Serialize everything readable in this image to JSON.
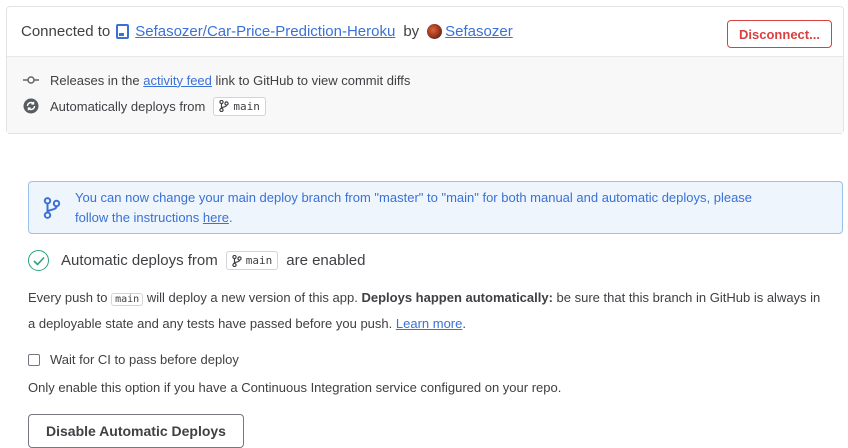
{
  "header": {
    "connected_to": "Connected to",
    "repo": "Sefasozer/Car-Price-Prediction-Heroku",
    "by": "by",
    "user": "Sefasozer",
    "disconnect": "Disconnect..."
  },
  "info": {
    "releases_pre": "Releases in the",
    "releases_link": "activity feed",
    "releases_post": "link to GitHub to view commit diffs",
    "auto_label": "Automatically deploys from",
    "branch": "main"
  },
  "banner": {
    "text1": "You can now change your main deploy branch from \"master\" to \"main\" for both manual and automatic deploys, please",
    "text2": "follow the instructions",
    "link": "here",
    "period": "."
  },
  "status": {
    "pre": "Automatic deploys from",
    "branch": "main",
    "post": "are enabled"
  },
  "description": {
    "every_push": "Every push to",
    "branch": "main",
    "will_deploy": "will deploy a new version of this app.",
    "bold": "Deploys happen automatically:",
    "rest": "be sure that this branch in GitHub is always in a deployable state and any tests have passed before you push.",
    "learn_more": "Learn more",
    "period": "."
  },
  "ci": {
    "label": "Wait for CI to pass before deploy",
    "checked": false,
    "note": "Only enable this option if you have a Continuous Integration service configured on your repo."
  },
  "actions": {
    "disable": "Disable Automatic Deploys"
  },
  "colors": {
    "link": "#3a71d6",
    "danger": "#d64242",
    "success": "#2fa37a",
    "info_bg": "#eef5fd"
  }
}
